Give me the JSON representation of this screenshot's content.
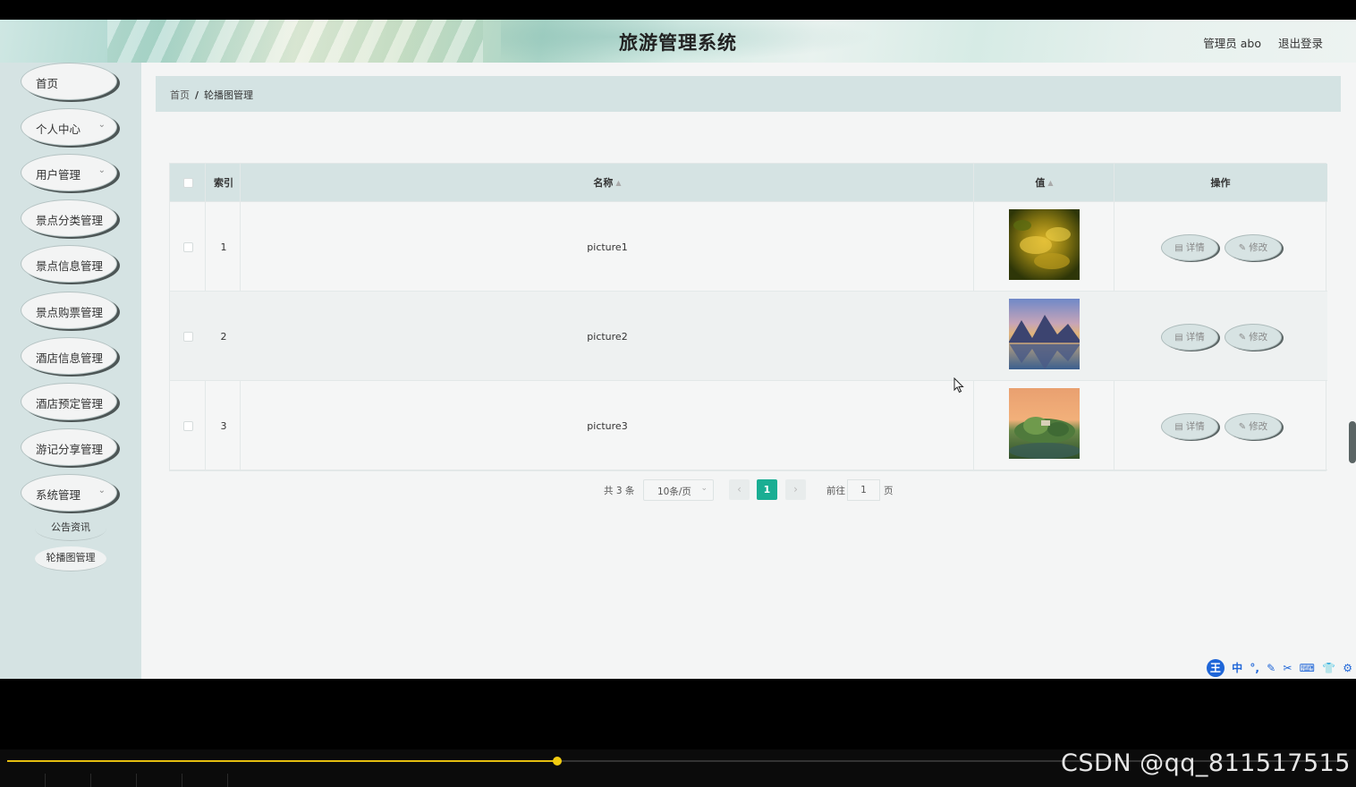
{
  "header": {
    "title": "旅游管理系统",
    "user_label": "管理员 abo",
    "logout_label": "退出登录"
  },
  "sidebar": {
    "items": [
      {
        "label": "首页",
        "has_arrow": false
      },
      {
        "label": "个人中心",
        "has_arrow": true
      },
      {
        "label": "用户管理",
        "has_arrow": true
      },
      {
        "label": "景点分类管理",
        "has_arrow": false
      },
      {
        "label": "景点信息管理",
        "has_arrow": false
      },
      {
        "label": "景点购票管理",
        "has_arrow": false
      },
      {
        "label": "酒店信息管理",
        "has_arrow": false
      },
      {
        "label": "酒店预定管理",
        "has_arrow": false
      },
      {
        "label": "游记分享管理",
        "has_arrow": false
      },
      {
        "label": "系统管理",
        "has_arrow": true
      }
    ],
    "sub_items": [
      {
        "label": "公告资讯"
      },
      {
        "label": "轮播图管理"
      }
    ]
  },
  "breadcrumb": {
    "home": "首页",
    "separator": "/",
    "current": "轮播图管理"
  },
  "table": {
    "columns": {
      "index": "索引",
      "name": "名称",
      "value": "值",
      "actions": "操作"
    },
    "rows": [
      {
        "index": "1",
        "name": "picture1",
        "thumb": "autumn-leaves"
      },
      {
        "index": "2",
        "name": "picture2",
        "thumb": "mountain-lake"
      },
      {
        "index": "3",
        "name": "picture3",
        "thumb": "sunset-island"
      }
    ],
    "action_labels": {
      "detail": "详情",
      "edit": "修改"
    }
  },
  "pagination": {
    "total": "共 3 条",
    "page_size": "10条/页",
    "current_page": "1",
    "goto_label": "前往",
    "goto_value": "1",
    "goto_unit": "页"
  },
  "ime_toolbar": {
    "logo": "王",
    "items": [
      "中",
      "°,",
      "✎",
      "✂",
      "⌨",
      "👕",
      "⚙"
    ]
  },
  "player": {
    "progress": 0.41,
    "watermark": "CSDN @qq_811517515"
  },
  "colors": {
    "accent": "#1aae93",
    "sidebar_bg": "#d5e3e3",
    "progress": "#e4bd10"
  }
}
